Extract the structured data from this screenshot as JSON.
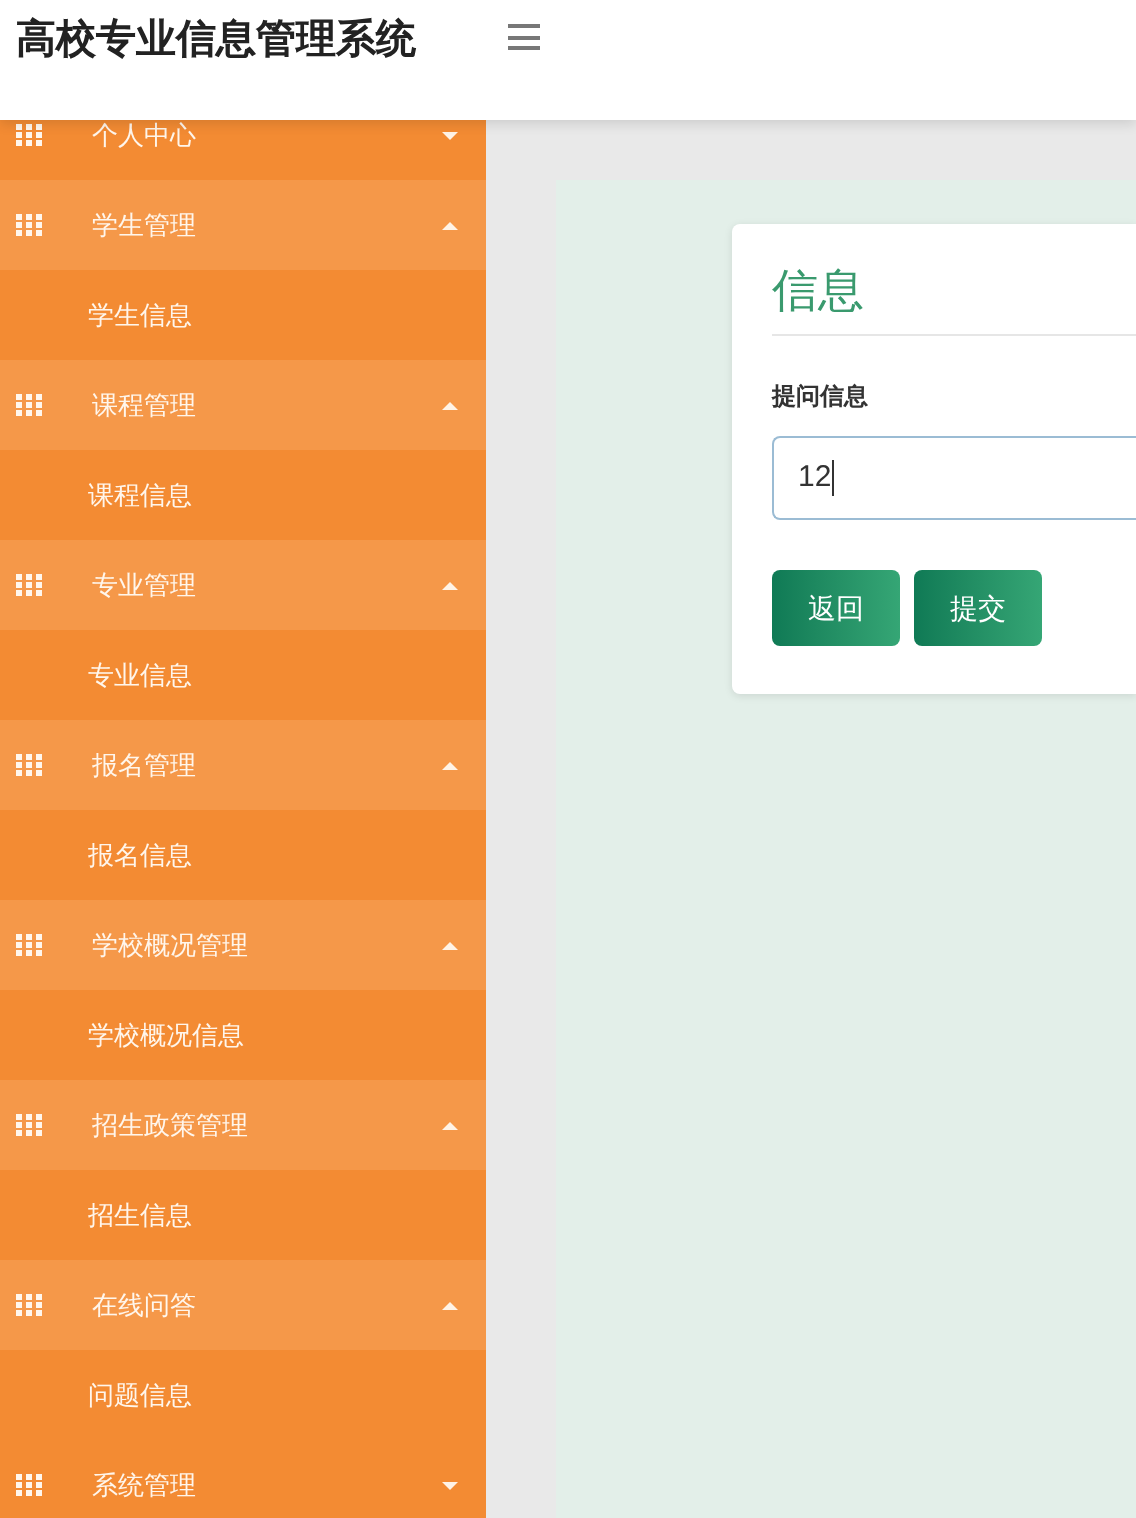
{
  "header": {
    "title": "高校专业信息管理系统"
  },
  "sidebar": {
    "items": [
      {
        "label": "个人中心",
        "expanded": false
      },
      {
        "label": "学生管理",
        "expanded": true,
        "children": [
          "学生信息"
        ]
      },
      {
        "label": "课程管理",
        "expanded": true,
        "children": [
          "课程信息"
        ]
      },
      {
        "label": "专业管理",
        "expanded": true,
        "children": [
          "专业信息"
        ]
      },
      {
        "label": "报名管理",
        "expanded": true,
        "children": [
          "报名信息"
        ]
      },
      {
        "label": "学校概况管理",
        "expanded": true,
        "children": [
          "学校概况信息"
        ]
      },
      {
        "label": "招生政策管理",
        "expanded": true,
        "children": [
          "招生信息"
        ]
      },
      {
        "label": "在线问答",
        "expanded": true,
        "children": [
          "问题信息"
        ]
      },
      {
        "label": "系统管理",
        "expanded": false
      }
    ]
  },
  "form": {
    "title": "信息",
    "field_label": "提问信息",
    "field_value": "12",
    "buttons": [
      "返回",
      "提交"
    ]
  }
}
